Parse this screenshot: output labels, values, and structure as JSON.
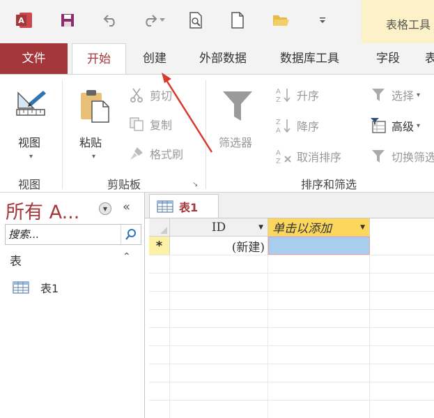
{
  "app": {
    "icon": "access-icon"
  },
  "quick_access": {
    "icons": [
      "access-icon",
      "save-icon",
      "undo-icon",
      "redo-icon",
      "print-preview-icon",
      "new-document-icon",
      "open-folder-icon",
      "customize-dropdown-icon"
    ]
  },
  "context_tab": {
    "label": "表格工具"
  },
  "tabs": {
    "file": "文件",
    "home": "开始",
    "create": "创建",
    "external": "外部数据",
    "dbtools": "数据库工具",
    "fields": "字段"
  },
  "ribbon": {
    "views": {
      "button": "视图",
      "group": "视图"
    },
    "clipboard": {
      "paste": "粘贴",
      "cut": "剪切",
      "copy": "复制",
      "format_painter": "格式刷",
      "group": "剪贴板"
    },
    "sort_filter": {
      "filter": "筛选器",
      "ascending": "升序",
      "descending": "降序",
      "clear_sort": "取消排序",
      "selection": "选择",
      "advanced": "高级",
      "toggle_filter": "切换筛选",
      "group": "排序和筛选"
    }
  },
  "nav": {
    "title": "所有 A...",
    "search_placeholder": "搜索...",
    "group": "表",
    "items": [
      {
        "label": "表1",
        "icon": "table-icon"
      }
    ]
  },
  "document": {
    "tab_label": "表1",
    "columns": [
      "ID",
      "单击以添加"
    ],
    "new_row_marker": "*",
    "new_row_value": "(新建)"
  },
  "colors": {
    "accent": "#a4373a",
    "context_tab_bg": "#fdf1c8",
    "selected_cell": "#a9cdec",
    "header_highlight": "#fbd85d",
    "row_selector": "#fdf1a6",
    "annotation_arrow": "#d93a2f"
  }
}
